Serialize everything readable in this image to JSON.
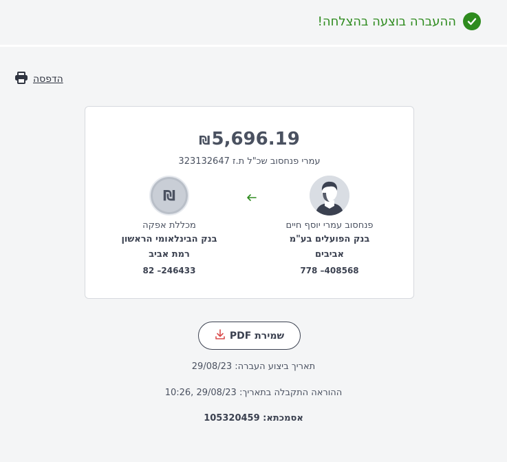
{
  "header": {
    "success_message": "ההעברה בוצעה בהצלחה!",
    "success_icon": "check-circle-icon",
    "accent_color": "#2e8b1e"
  },
  "print": {
    "label": "הדפסה",
    "icon": "printer-icon"
  },
  "transfer": {
    "currency_symbol": "₪",
    "amount": "5,696.19",
    "description": "עמרי פנחסוב שכ\"ל ת.ז 323132647",
    "direction_icon": "arrow-left-icon"
  },
  "from": {
    "avatar_icon": "person-avatar-icon",
    "name": "פנחסוב עמרי יוסף חיים",
    "bank": "בנק הפועלים בע\"מ",
    "branch": "אביבים",
    "account": "778 –408568"
  },
  "to": {
    "avatar_icon": "shekel-icon",
    "avatar_glyph": "₪",
    "name": "מכללת אפקה",
    "bank": "בנק הבינלאומי הראשון",
    "branch": "רמת אביב",
    "account": "82 –246433"
  },
  "pdf": {
    "label": "שמירת PDF",
    "icon": "download-icon"
  },
  "details": {
    "execution_date": "תאריך ביצוע העברה: 29/08/23",
    "received_date": "ההוראה התקבלה בתאריך: 29/08/23 ,10:26",
    "reference": "אסמכתא: 105320459"
  }
}
